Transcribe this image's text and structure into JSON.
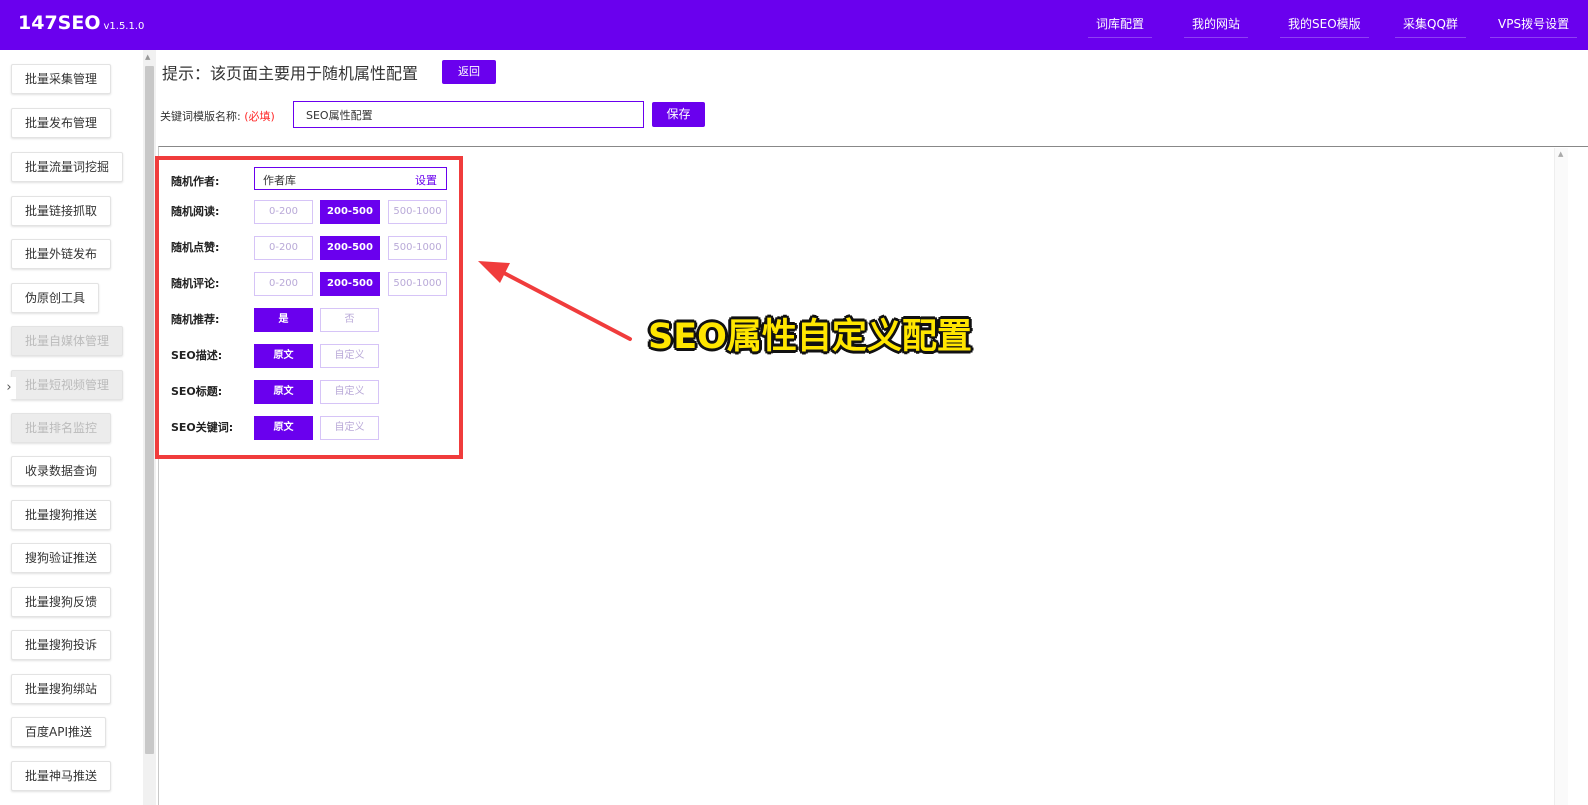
{
  "header": {
    "brand": "147SEO",
    "version": "v1.5.1.0",
    "nav": [
      "词库配置",
      "我的网站",
      "我的SEO模版",
      "采集QQ群",
      "VPS拨号设置"
    ],
    "bg_color": "#6a00ee"
  },
  "sidebar": {
    "items": [
      {
        "label": "批量采集管理",
        "enabled": true
      },
      {
        "label": "批量发布管理",
        "enabled": true
      },
      {
        "label": "批量流量词挖掘",
        "enabled": true
      },
      {
        "label": "批量链接抓取",
        "enabled": true
      },
      {
        "label": "批量外链发布",
        "enabled": true
      },
      {
        "label": "伪原创工具",
        "enabled": true
      },
      {
        "label": "批量自媒体管理",
        "enabled": false
      },
      {
        "label": "批量短视频管理",
        "enabled": false
      },
      {
        "label": "批量排名监控",
        "enabled": false
      },
      {
        "label": "收录数据查询",
        "enabled": true
      },
      {
        "label": "批量搜狗推送",
        "enabled": true
      },
      {
        "label": "搜狗验证推送",
        "enabled": true
      },
      {
        "label": "批量搜狗反馈",
        "enabled": true
      },
      {
        "label": "批量搜狗投诉",
        "enabled": true
      },
      {
        "label": "批量搜狗绑站",
        "enabled": true
      },
      {
        "label": "百度API推送",
        "enabled": true
      },
      {
        "label": "批量神马推送",
        "enabled": true
      }
    ],
    "collapse_icon": "chevron-right-icon"
  },
  "main": {
    "hint": "提示：该页面主要用于随机属性配置",
    "back_label": "返回",
    "template_label": "关键词模版名称:",
    "required_mark": "(必填)",
    "template_name": "SEO属性配置",
    "save_label": "保存"
  },
  "config": {
    "author": {
      "label": "随机作者:",
      "value": "作者库",
      "set_label": "设置"
    },
    "reads": {
      "label": "随机阅读:",
      "options": [
        "0-200",
        "200-500",
        "500-1000"
      ],
      "selected": 1
    },
    "likes": {
      "label": "随机点赞:",
      "options": [
        "0-200",
        "200-500",
        "500-1000"
      ],
      "selected": 1
    },
    "comments": {
      "label": "随机评论:",
      "options": [
        "0-200",
        "200-500",
        "500-1000"
      ],
      "selected": 1
    },
    "recommend": {
      "label": "随机推荐:",
      "options": [
        "是",
        "否"
      ],
      "selected": 0
    },
    "seo_desc": {
      "label": "SEO描述:",
      "options": [
        "原文",
        "自定义"
      ],
      "selected": 0
    },
    "seo_title": {
      "label": "SEO标题:",
      "options": [
        "原文",
        "自定义"
      ],
      "selected": 0
    },
    "seo_keywords": {
      "label": "SEO关键词:",
      "options": [
        "原文",
        "自定义"
      ],
      "selected": 0
    }
  },
  "annotation": {
    "text": "SEO属性自定义配置",
    "box_color": "#f03c3c",
    "text_color": "#ffe600"
  }
}
